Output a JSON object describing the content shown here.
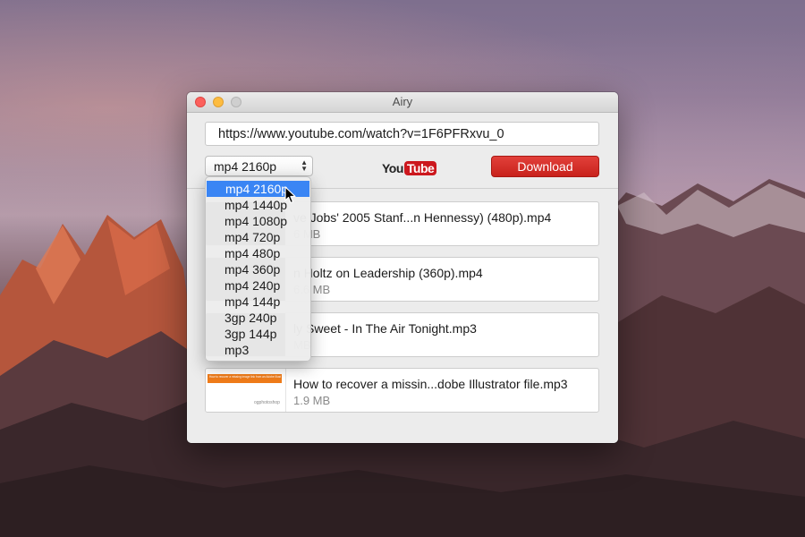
{
  "window": {
    "title": "Airy"
  },
  "url_field": {
    "value": "https://www.youtube.com/watch?v=1F6PFRxvu_0"
  },
  "format_select": {
    "selected": "mp4 2160p"
  },
  "youtube_logo": {
    "you": "You",
    "tube": "Tube"
  },
  "download_button": {
    "label": "Download"
  },
  "dropdown": {
    "options": [
      "mp4 2160p",
      "mp4 1440p",
      "mp4 1080p",
      "mp4 720p",
      "mp4 480p",
      "mp4 360p",
      "mp4 240p",
      "mp4 144p",
      "3gp 240p",
      "3gp 144p",
      "mp3"
    ],
    "highlighted_index": 0
  },
  "downloads": [
    {
      "name": "ve Jobs' 2005 Stanf...n Hennessy) (480p).mp4",
      "size": "6 MB",
      "thumb": "video"
    },
    {
      "name": "n Holtz on Leadership (360p).mp4",
      "size": "6.6 MB",
      "thumb": "video"
    },
    {
      "name": "ly Sweet - In The Air Tonight.mp3",
      "size": "MB",
      "thumb": "video"
    },
    {
      "name": "How to recover a missin...dobe Illustrator file.mp3",
      "size": "1.9 MB",
      "thumb": "document"
    }
  ],
  "thumbnail_doc": {
    "banner_text": "How to recover a missing image link from an Adobe Illustrator file",
    "brand": "ogphotoshop"
  },
  "colors": {
    "download_red": "#d42e28",
    "youtube_red": "#cc181e",
    "selection_blue": "#3a85f4"
  },
  "icons": {
    "close": "close-dot-icon",
    "minimize": "minimize-dot-icon",
    "maximize": "maximize-dot-icon",
    "select_arrows": "updown-arrows-icon",
    "cursor": "mouse-pointer-icon"
  }
}
